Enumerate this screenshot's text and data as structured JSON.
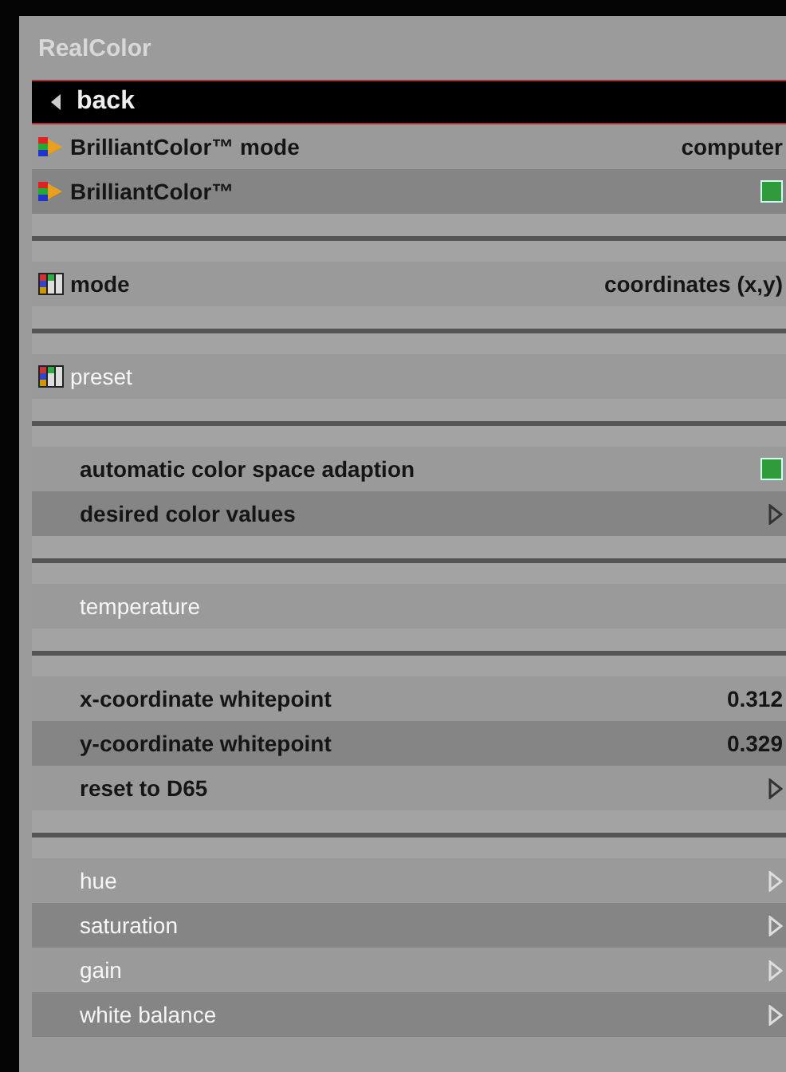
{
  "window": {
    "title": "RealColor"
  },
  "items": [
    {
      "kind": "back",
      "label": "back",
      "selected": true
    },
    {
      "kind": "value",
      "label": "BrilliantColor™ mode",
      "value": "computer",
      "disabled": false,
      "indented": false
    },
    {
      "kind": "checkbox",
      "label": "BrilliantColor™",
      "checked": true,
      "disabled": false,
      "indented": false
    },
    {
      "kind": "separator"
    },
    {
      "kind": "value",
      "label": "mode",
      "value": "coordinates (x,y)",
      "disabled": false,
      "indented": false
    },
    {
      "kind": "separator"
    },
    {
      "kind": "plain",
      "label": "preset",
      "disabled": true,
      "indented": false
    },
    {
      "kind": "separator"
    },
    {
      "kind": "checkbox",
      "label": "automatic color space adaption",
      "checked": true,
      "disabled": false,
      "indented": true
    },
    {
      "kind": "submenu",
      "label": "desired color values",
      "disabled": false,
      "indented": true
    },
    {
      "kind": "separator"
    },
    {
      "kind": "plain",
      "label": "temperature",
      "disabled": true,
      "indented": true
    },
    {
      "kind": "separator"
    },
    {
      "kind": "value",
      "label": "x-coordinate whitepoint",
      "value": "0.312",
      "disabled": false,
      "indented": true
    },
    {
      "kind": "value",
      "label": "y-coordinate whitepoint",
      "value": "0.329",
      "disabled": false,
      "indented": true
    },
    {
      "kind": "submenu",
      "label": "reset to D65",
      "disabled": false,
      "indented": true
    },
    {
      "kind": "separator"
    },
    {
      "kind": "submenu",
      "label": "hue",
      "disabled": true,
      "indented": true
    },
    {
      "kind": "submenu",
      "label": "saturation",
      "disabled": true,
      "indented": true
    },
    {
      "kind": "submenu",
      "label": "gain",
      "disabled": true,
      "indented": true
    },
    {
      "kind": "submenu",
      "label": "white balance",
      "disabled": true,
      "indented": true
    }
  ]
}
